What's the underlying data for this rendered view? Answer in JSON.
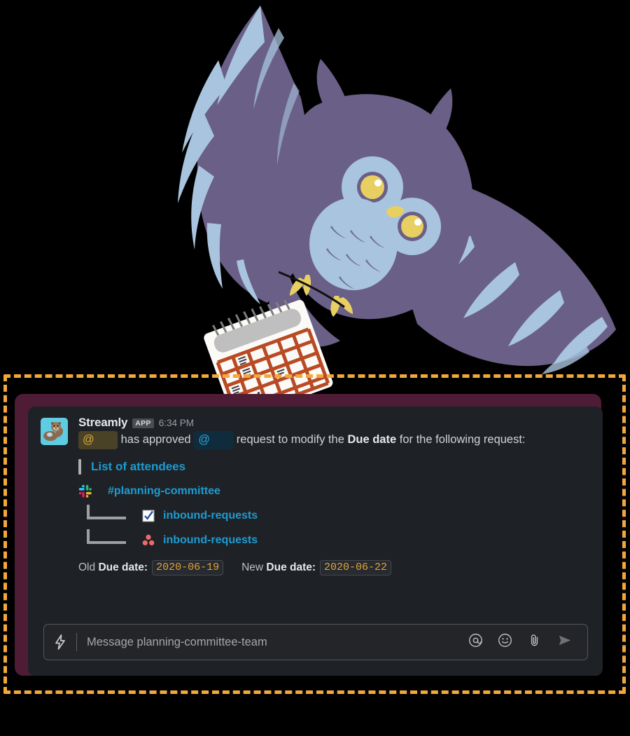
{
  "hero": {
    "owl_alt": "flying-owl-illustration",
    "calendar_alt": "spiral-calendar-illustration",
    "colors": {
      "owl_body": "#6A5F87",
      "owl_accent": "#A8C4DE",
      "owl_eye": "#E8CF62",
      "owl_beak": "#E8CF62",
      "calendar_grid": "#B94A23",
      "calendar_paper": "#FBFAF7",
      "calendar_spine": "#BFBFBF",
      "background": "#000000"
    }
  },
  "frame": {
    "dash_color": "#F2A83B",
    "maroon_card_color": "#4E1C35",
    "slack_card_color": "#1E2227"
  },
  "message": {
    "avatar_icon": "otter-emoji",
    "avatar_bg": "#5ECDE4",
    "author": "Streamly",
    "app_badge": "APP",
    "timestamp": "6:34 PM",
    "text": {
      "mention_approver": "@",
      "middle": "has approved",
      "mention_requester": "@",
      "after_1": "request to modify the",
      "bold_field": "Due date",
      "after_2": "for the following request:"
    },
    "mention_gold_bg": "#4A4226",
    "mention_gold_fg": "#D9A93C",
    "mention_blue_bg": "#102C3C",
    "mention_blue_fg": "#2BA3DE"
  },
  "attachment": {
    "title": "List of attendees",
    "channel": {
      "icon": "slack-logo-icon",
      "label": "#planning-committee"
    },
    "rows": [
      {
        "icon": "white-check-mark-emoji",
        "label": "inbound-requests"
      },
      {
        "icon": "asana-logo-icon",
        "label": "inbound-requests"
      }
    ],
    "dates": {
      "old_prefix": "Old",
      "old_field": "Due date:",
      "old_value": "2020-06-19",
      "new_prefix": "New",
      "new_field": "Due date:",
      "new_value": "2020-06-22",
      "value_color": "#E0A33E"
    },
    "link_color": "#1D9BD1"
  },
  "composer": {
    "bolt_icon": "lightning-bolt-icon",
    "placeholder": "Message planning-committee-team",
    "icons": [
      {
        "name": "mention-icon",
        "glyph": "@"
      },
      {
        "name": "emoji-icon",
        "glyph": "smiley"
      },
      {
        "name": "attachment-icon",
        "glyph": "paperclip"
      },
      {
        "name": "send-icon",
        "glyph": "paper-plane"
      }
    ]
  }
}
